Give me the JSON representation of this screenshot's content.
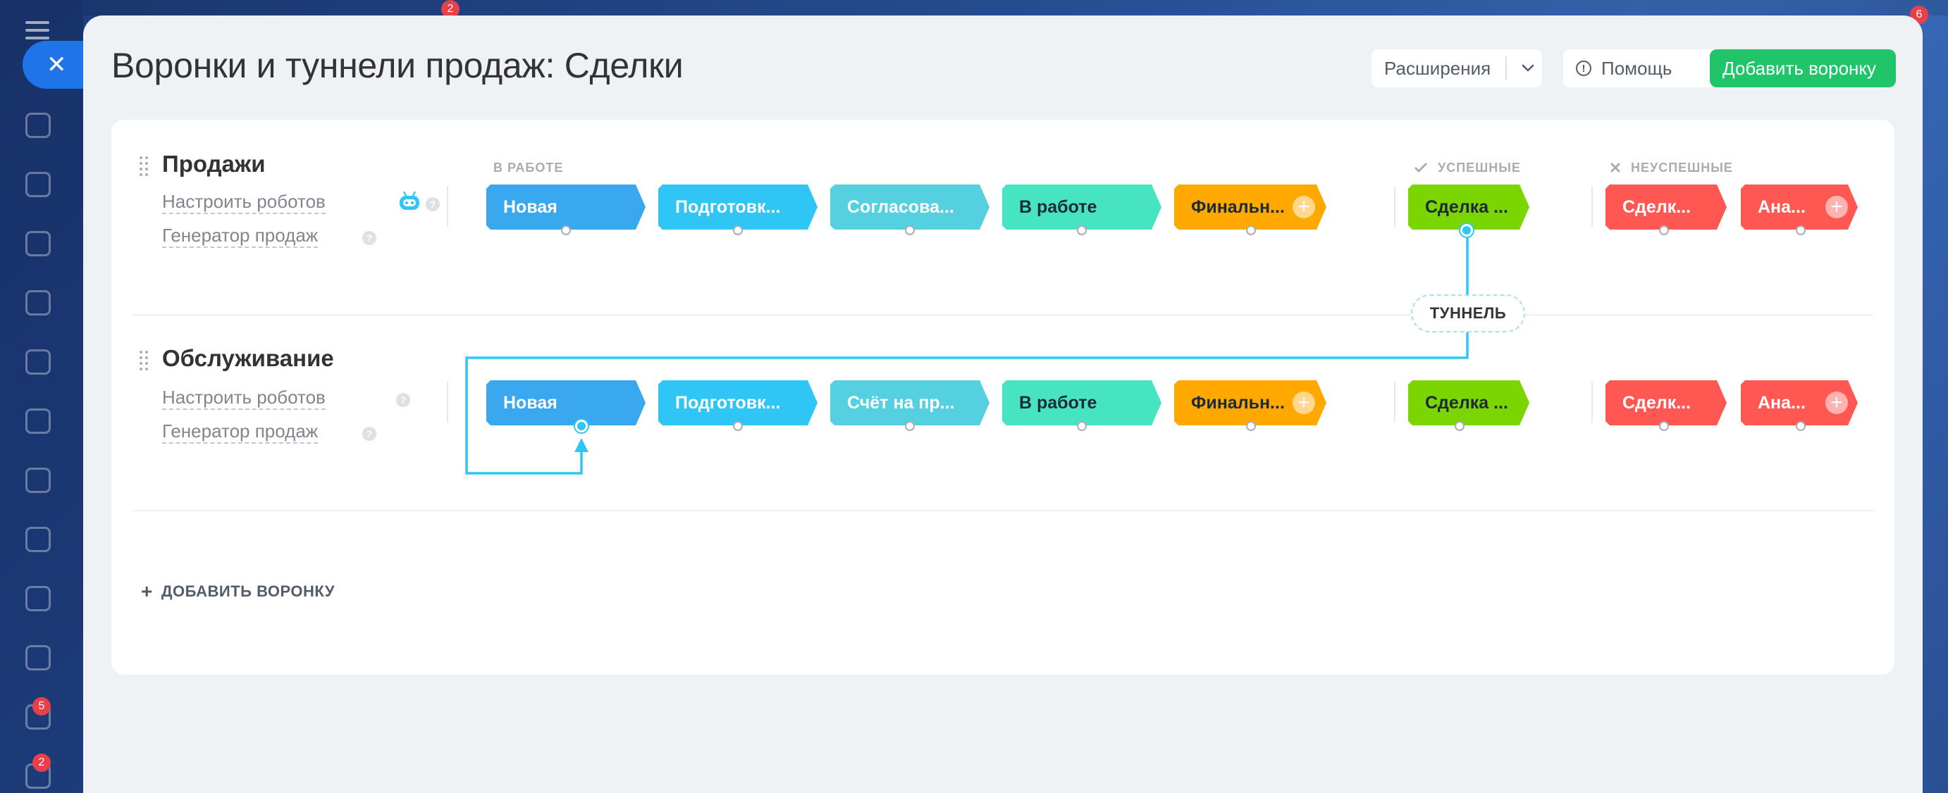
{
  "background": {
    "badges": [
      "2",
      "6",
      "5",
      "2"
    ]
  },
  "slider": {
    "title": "Воронки и туннели продаж: Сделки",
    "extensions_label": "Расширения",
    "help_label": "Помощь",
    "add_funnel_label": "Добавить воронку"
  },
  "groups": {
    "in_work": "В РАБОТЕ",
    "success": "УСПЕШНЫЕ",
    "fail": "НЕУСПЕШНЫЕ"
  },
  "funnels": [
    {
      "name": "Продажи",
      "robots_link": "Настроить роботов",
      "generator_link": "Генератор продаж",
      "stages": [
        {
          "label": "Новая",
          "color": "#39a8ef"
        },
        {
          "label": "Подготовк...",
          "color": "#2fc6f6"
        },
        {
          "label": "Согласова...",
          "color": "#55d0e0"
        },
        {
          "label": "В работе",
          "color": "#47e4c2"
        },
        {
          "label": "Финальн...",
          "color": "#ffa900"
        },
        {
          "label": "Сделка ...",
          "color": "#7bd500"
        },
        {
          "label": "Сделк...",
          "color": "#ff5752"
        },
        {
          "label": "Ана...",
          "color": "#ff5752"
        }
      ]
    },
    {
      "name": "Обслуживание",
      "robots_link": "Настроить роботов",
      "generator_link": "Генератор продаж",
      "stages": [
        {
          "label": "Новая",
          "color": "#39a8ef"
        },
        {
          "label": "Подготовк...",
          "color": "#2fc6f6"
        },
        {
          "label": "Счёт на пр...",
          "color": "#55d0e0"
        },
        {
          "label": "В работе",
          "color": "#47e4c2"
        },
        {
          "label": "Финальн...",
          "color": "#ffa900"
        },
        {
          "label": "Сделка ...",
          "color": "#7bd500"
        },
        {
          "label": "Сделк...",
          "color": "#ff5752"
        },
        {
          "label": "Ана...",
          "color": "#ff5752"
        }
      ]
    }
  ],
  "tunnel_label": "ТУННЕЛЬ",
  "add_funnel_link": "ДОБАВИТЬ ВОРОНКУ",
  "icons": {
    "close": "close-icon",
    "chevron": "chevron-down-icon",
    "help": "info-icon",
    "robot": "robot-icon",
    "drag": "drag-handle-icon",
    "check": "check-icon",
    "cross": "cross-icon",
    "plus": "plus-icon"
  }
}
